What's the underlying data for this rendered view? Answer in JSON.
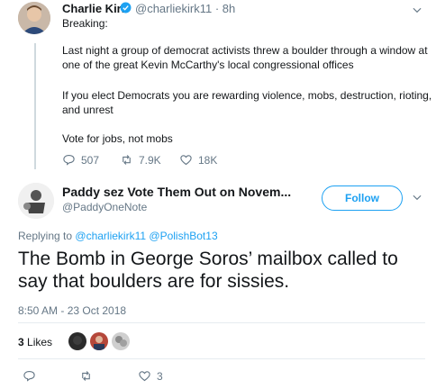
{
  "tweet1": {
    "name": "Charlie Kirk",
    "handle": "@charliekirk11",
    "time": "· 8h",
    "text": {
      "breaking": "Breaking:",
      "line1": "Last night a group of democrat activists threw a boulder through a window at",
      "line2": "one of the great Kevin McCarthy's local congressional offices",
      "line3": "If you elect Democrats you are rewarding violence, mobs, destruction, rioting,",
      "line4": "and unrest",
      "line5": "Vote for jobs, not mobs"
    },
    "replies": "507",
    "retweets": "7.9K",
    "likes": "18K",
    "verified_color": "#1da1f2"
  },
  "tweet2": {
    "name": "Paddy sez Vote Them Out on Novem...",
    "handle": "@PaddyOneNote",
    "follow_label": "Follow",
    "replying_prefix": "Replying to",
    "replying_to_1": "@charliekirk11",
    "replying_to_2": "@PolishBot13",
    "text_line1": "The Bomb in George Soros’ mailbox called to",
    "text_line2": "say that boulders are for sissies.",
    "timestamp": "8:50 AM - 23 Oct 2018",
    "likes_count": "3",
    "likes_label": "Likes",
    "action_likes": "3"
  },
  "icons": {
    "reply": "reply-icon",
    "retweet": "retweet-icon",
    "like": "heart-icon",
    "more": "chevron-down-icon"
  },
  "colors": {
    "accent": "#1da1f2",
    "muted": "#657786",
    "text": "#14171a",
    "border": "#e6ecf0"
  }
}
